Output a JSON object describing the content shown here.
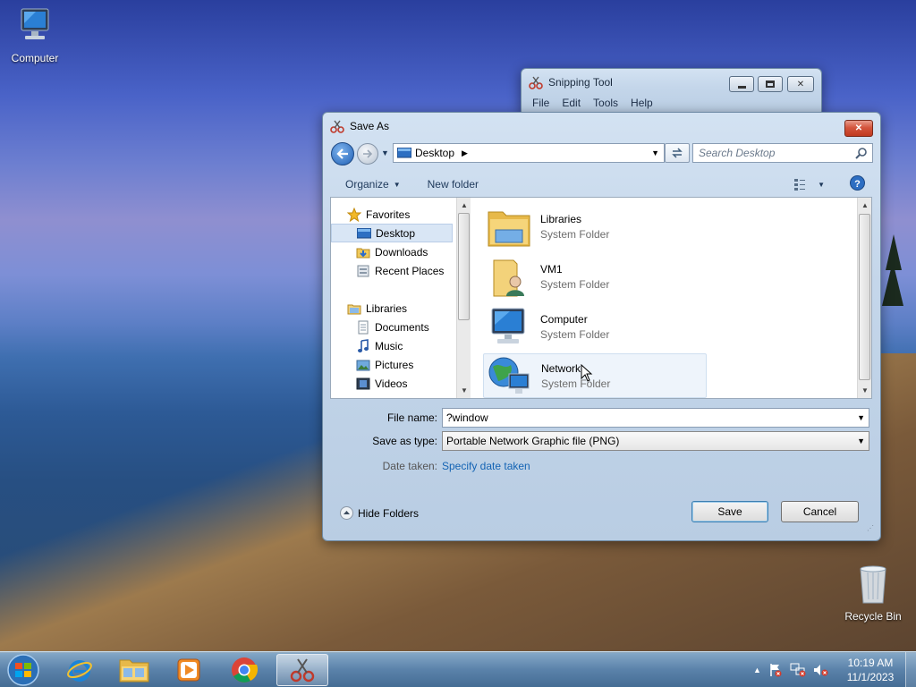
{
  "desktop": {
    "computer_label": "Computer",
    "recycle_bin_label": "Recycle Bin"
  },
  "snipping_tool": {
    "title": "Snipping Tool",
    "menu": [
      "File",
      "Edit",
      "Tools",
      "Help"
    ]
  },
  "save_as": {
    "title": "Save As",
    "address_location": "Desktop",
    "search_placeholder": "Search Desktop",
    "toolbar": {
      "organize": "Organize",
      "new_folder": "New folder"
    },
    "nav": {
      "favorites": "Favorites",
      "desktop": "Desktop",
      "downloads": "Downloads",
      "recent_places": "Recent Places",
      "libraries": "Libraries",
      "documents": "Documents",
      "music": "Music",
      "pictures": "Pictures",
      "videos": "Videos"
    },
    "files": [
      {
        "name": "Libraries",
        "type": "System Folder"
      },
      {
        "name": "VM1",
        "type": "System Folder"
      },
      {
        "name": "Computer",
        "type": "System Folder"
      },
      {
        "name": "Network",
        "type": "System Folder"
      }
    ],
    "file_name_label": "File name:",
    "file_name_value": "?window",
    "save_as_type_label": "Save as type:",
    "save_as_type_value": "Portable Network Graphic file (PNG)",
    "date_taken_label": "Date taken:",
    "date_taken_link": "Specify date taken",
    "hide_folders": "Hide Folders",
    "save_button": "Save",
    "cancel_button": "Cancel"
  },
  "taskbar": {
    "time": "10:19 AM",
    "date": "11/1/2023"
  }
}
